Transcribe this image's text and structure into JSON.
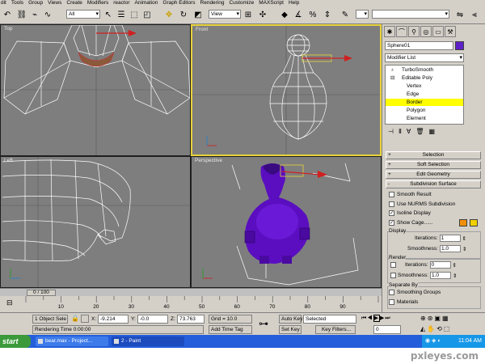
{
  "menubar": [
    "dit",
    "Tools",
    "Group",
    "Views",
    "Create",
    "Modifiers",
    "reactor",
    "Animation",
    "Graph Editors",
    "Rendering",
    "Customize",
    "MAXScript",
    "Help"
  ],
  "toolbar": {
    "selection_filter": "All",
    "reference_coord": "View",
    "named_selection": ""
  },
  "viewports": {
    "top": "Top",
    "front": "Front",
    "left": "Left",
    "perspective": "Perspective"
  },
  "panel": {
    "object_name": "Sphere01",
    "object_color": "#5e20c8",
    "modifier_list": "Modifier List",
    "stack": [
      {
        "label": "TurboSmooth",
        "selected": false
      },
      {
        "label": "Editable Poly",
        "selected": false
      },
      {
        "label": "Vertex",
        "selected": false
      },
      {
        "label": "Edge",
        "selected": false
      },
      {
        "label": "Border",
        "selected": true
      },
      {
        "label": "Polygon",
        "selected": false
      },
      {
        "label": "Element",
        "selected": false
      }
    ],
    "rollouts": {
      "selection": "Selection",
      "soft_selection": "Soft Selection",
      "edit_geometry": "Edit Geometry",
      "subdivision_surface": "Subdivision Surface"
    },
    "subdiv": {
      "smooth_result": "Smooth Result",
      "use_nurms": "Use NURMS Subdivision",
      "isoline_display": "Isoline Display",
      "show_cage": "Show Cage......",
      "display_label": "Display",
      "iterations_label": "Iterations:",
      "display_iterations": "1",
      "smoothness_label": "Smoothness:",
      "display_smoothness": "1.0",
      "render_label": "Render",
      "render_iterations": "0",
      "render_smoothness": "1.0",
      "separate_by": "Separate By",
      "smoothing_groups": "Smoothing Groups",
      "materials": "Materials",
      "cage_color_1": "#f0900a",
      "cage_color_2": "#f0d000"
    }
  },
  "timeslider": {
    "position": "0 / 100",
    "ticks": [
      "10",
      "20",
      "30",
      "40",
      "50",
      "60",
      "70",
      "80",
      "90"
    ]
  },
  "status": {
    "objects_selected": "1 Object Sele",
    "x_label": "X:",
    "x_value": "-9.214",
    "y_label": "Y:",
    "y_value": "-0.0",
    "z_label": "Z:",
    "z_value": "73.763",
    "grid": "Grid = 10.0",
    "rendering_time": "Rendering Time  0:00:00",
    "add_time_tag": "Add Time Tag",
    "auto_key": "Auto Key",
    "set_key": "Set Key",
    "selected": "Selected",
    "key_filters": "Key Filters...",
    "current_frame": "0"
  },
  "taskbar": {
    "start": "start",
    "task1": "bear.max",
    "task1b": "- Project...",
    "task2": "2 - Paint",
    "clock": "11:04 AM"
  },
  "watermark": "pxleyes.com"
}
